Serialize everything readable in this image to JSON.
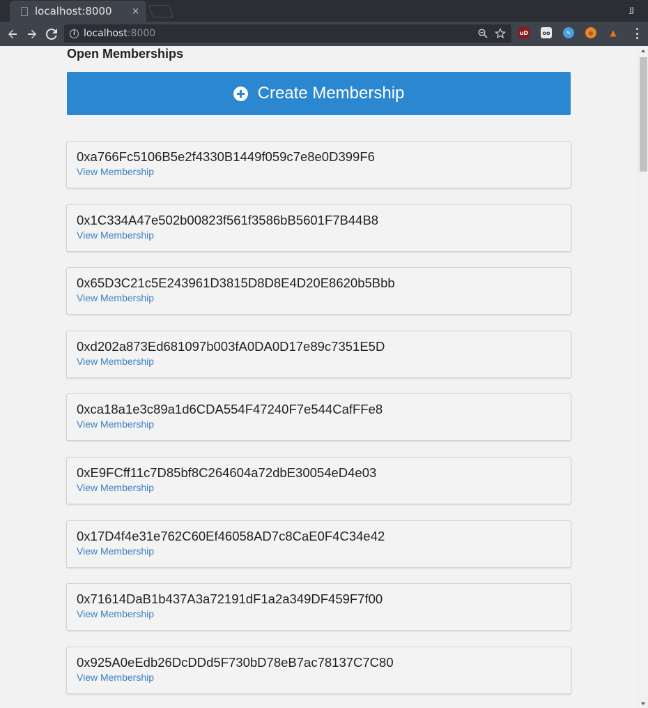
{
  "browser": {
    "tab_title": "localhost:8000",
    "tab_close": "×",
    "profile": "JJ",
    "url_host": "localhost",
    "url_port": ":8000",
    "info_glyph": "i",
    "extensions": [
      {
        "name": "ublock-origin",
        "label": "uD",
        "color": "#8b1a1a"
      },
      {
        "name": "ghostery",
        "label": "oo",
        "color": "#e8e8e8"
      },
      {
        "name": "feather",
        "label": "✎",
        "color": "#4a9fe0"
      },
      {
        "name": "basketball",
        "label": "●",
        "color": "#e8862a"
      },
      {
        "name": "metamask-fox",
        "label": "▲",
        "color": "#e2761b"
      }
    ]
  },
  "page": {
    "title": "Open Memberships",
    "create_button": "Create Membership",
    "link_label": "View Membership",
    "memberships": [
      "0xa766Fc5106B5e2f4330B1449f059c7e8e0D399F6",
      "0x1C334A47e502b00823f561f3586bB5601F7B44B8",
      "0x65D3C21c5E243961D3815D8D8E4D20E8620b5Bbb",
      "0xd202a873Ed681097b003fA0DA0D17e89c7351E5D",
      "0xca18a1e3c89a1d6CDA554F47240F7e544CafFFe8",
      "0xE9FCff11c7D85bf8C264604a72dbE30054eD4e03",
      "0x17D4f4e31e762C60Ef46058AD7c8CaE0F4C34e42",
      "0x71614DaB1b437A3a72191dF1a2a349DF459F7f00",
      "0x925A0eEdb26DcDDd5F730bD78eB7ac78137C7C80"
    ]
  },
  "colors": {
    "primary": "#2a87d0",
    "link": "#3b81c4",
    "background": "#f2f2f2"
  }
}
